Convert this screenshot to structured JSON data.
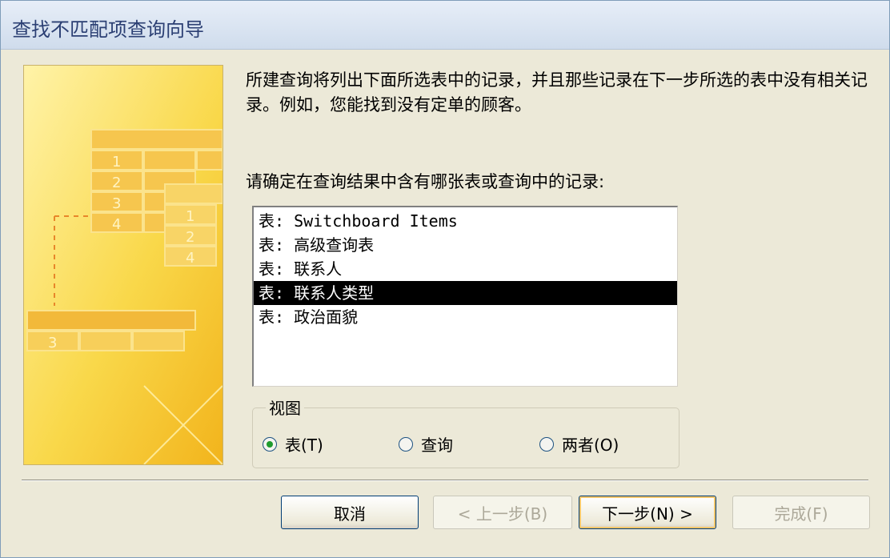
{
  "window": {
    "title": "查找不匹配项查询向导"
  },
  "description": "所建查询将列出下面所选表中的记录，并且那些记录在下一步所选的表中没有相关记录。例如，您能找到没有定单的顾客。",
  "prompt": "请确定在查询结果中含有哪张表或查询中的记录:",
  "listbox": {
    "items": [
      {
        "label": "表: Switchboard Items",
        "selected": false
      },
      {
        "label": "表: 高级查询表",
        "selected": false
      },
      {
        "label": "表: 联系人",
        "selected": false
      },
      {
        "label": "表: 联系人类型",
        "selected": true
      },
      {
        "label": "表: 政治面貌",
        "selected": false
      }
    ]
  },
  "view_group": {
    "legend": "视图",
    "options": [
      {
        "label": "表(T)",
        "checked": true
      },
      {
        "label": "查询",
        "checked": false
      },
      {
        "label": "两者(O)",
        "checked": false
      }
    ]
  },
  "illustration": {
    "labels": [
      "1",
      "2",
      "3",
      "4",
      "1",
      "2",
      "4",
      "3"
    ]
  },
  "buttons": {
    "cancel": "取消",
    "back": "< 上一步(B)",
    "next": "下一步(N) >",
    "finish": "完成(F)"
  },
  "colors": {
    "accent_yellow": "#f9d84a",
    "selection": "#000000",
    "title_text": "#2b3f73"
  }
}
